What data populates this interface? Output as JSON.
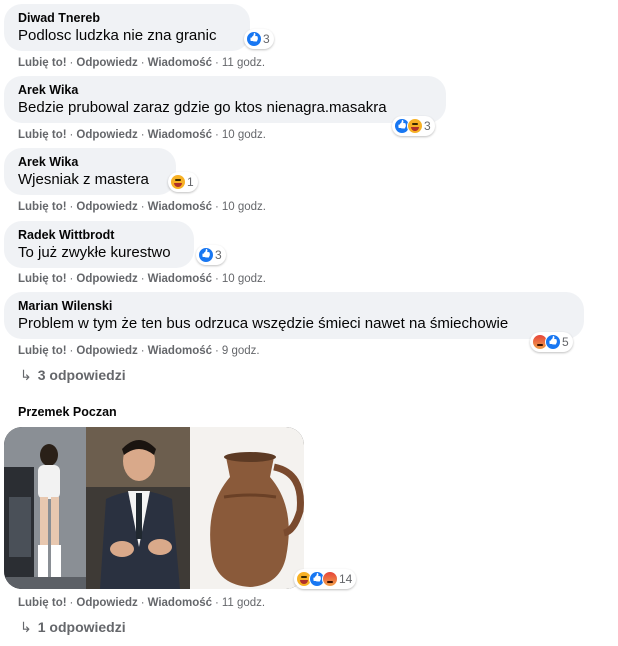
{
  "comments": [
    {
      "author": "Diwad Tnereb",
      "text": "Podlosc ludzka nie zna granic",
      "reaction_count": "3",
      "reactions": [
        "like"
      ],
      "actions": {
        "like": "Lubię to!",
        "reply": "Odpowiedz",
        "message": "Wiadomość"
      },
      "time": "11 godz."
    },
    {
      "author": "Arek Wika",
      "text": "Bedzie prubowal zaraz gdzie go ktos nienagra.masakra",
      "reaction_count": "3",
      "reactions": [
        "like",
        "haha"
      ],
      "actions": {
        "like": "Lubię to!",
        "reply": "Odpowiedz",
        "message": "Wiadomość"
      },
      "time": "10 godz."
    },
    {
      "author": "Arek Wika",
      "text": "Wjesniak z mastera",
      "reaction_count": "1",
      "reactions": [
        "haha"
      ],
      "actions": {
        "like": "Lubię to!",
        "reply": "Odpowiedz",
        "message": "Wiadomość"
      },
      "time": "10 godz."
    },
    {
      "author": "Radek Wittbrodt",
      "text": "To już zwykłe kurestwo",
      "reaction_count": "3",
      "reactions": [
        "like"
      ],
      "actions": {
        "like": "Lubię to!",
        "reply": "Odpowiedz",
        "message": "Wiadomość"
      },
      "time": "10 godz."
    },
    {
      "author": "Marian Wilenski",
      "text": "Problem w tym że ten bus odrzuca wszędzie śmieci nawet na śmiechowie",
      "reaction_count": "5",
      "reactions": [
        "angry",
        "like"
      ],
      "actions": {
        "like": "Lubię to!",
        "reply": "Odpowiedz",
        "message": "Wiadomość"
      },
      "time": "9 godz.",
      "replies_label": "3 odpowiedzi"
    },
    {
      "author": "Przemek Poczan",
      "reaction_count": "14",
      "reactions": [
        "haha",
        "like",
        "angry"
      ],
      "actions": {
        "like": "Lubię to!",
        "reply": "Odpowiedz",
        "message": "Wiadomość"
      },
      "time": "11 godz.",
      "replies_label": "1 odpowiedzi"
    }
  ],
  "colors": {
    "bubble": "#f0f2f5",
    "meta": "#65676b",
    "like": "#1877f2",
    "haha": "#f7b125",
    "angry": "#e6443a"
  }
}
